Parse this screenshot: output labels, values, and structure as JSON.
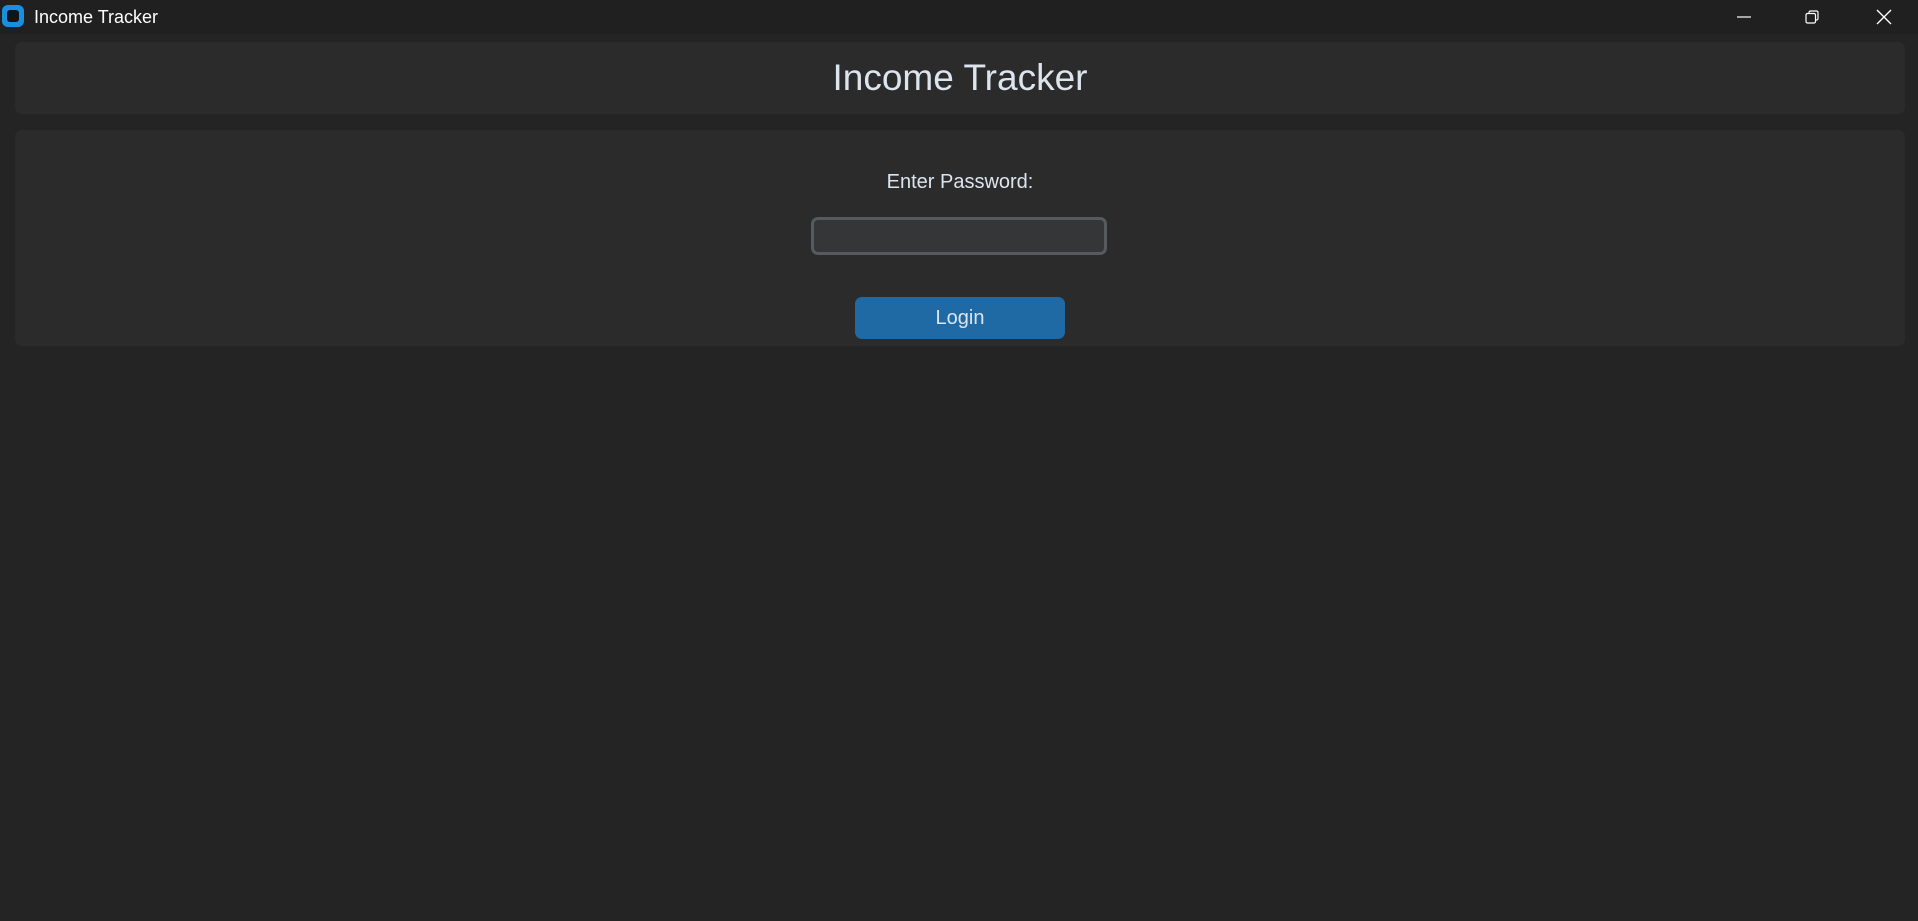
{
  "window": {
    "title": "Income Tracker",
    "icon": "app-icon",
    "controls": {
      "minimize": "minimize-icon",
      "maximize": "restore-icon",
      "close": "close-icon"
    }
  },
  "header": {
    "title": "Income Tracker"
  },
  "login": {
    "label": "Enter Password:",
    "password_value": "",
    "password_placeholder": "",
    "button_label": "Login"
  },
  "colors": {
    "background": "#242424",
    "panel": "#2b2b2b",
    "accent": "#1f6aa5",
    "text": "#dce4ee"
  }
}
